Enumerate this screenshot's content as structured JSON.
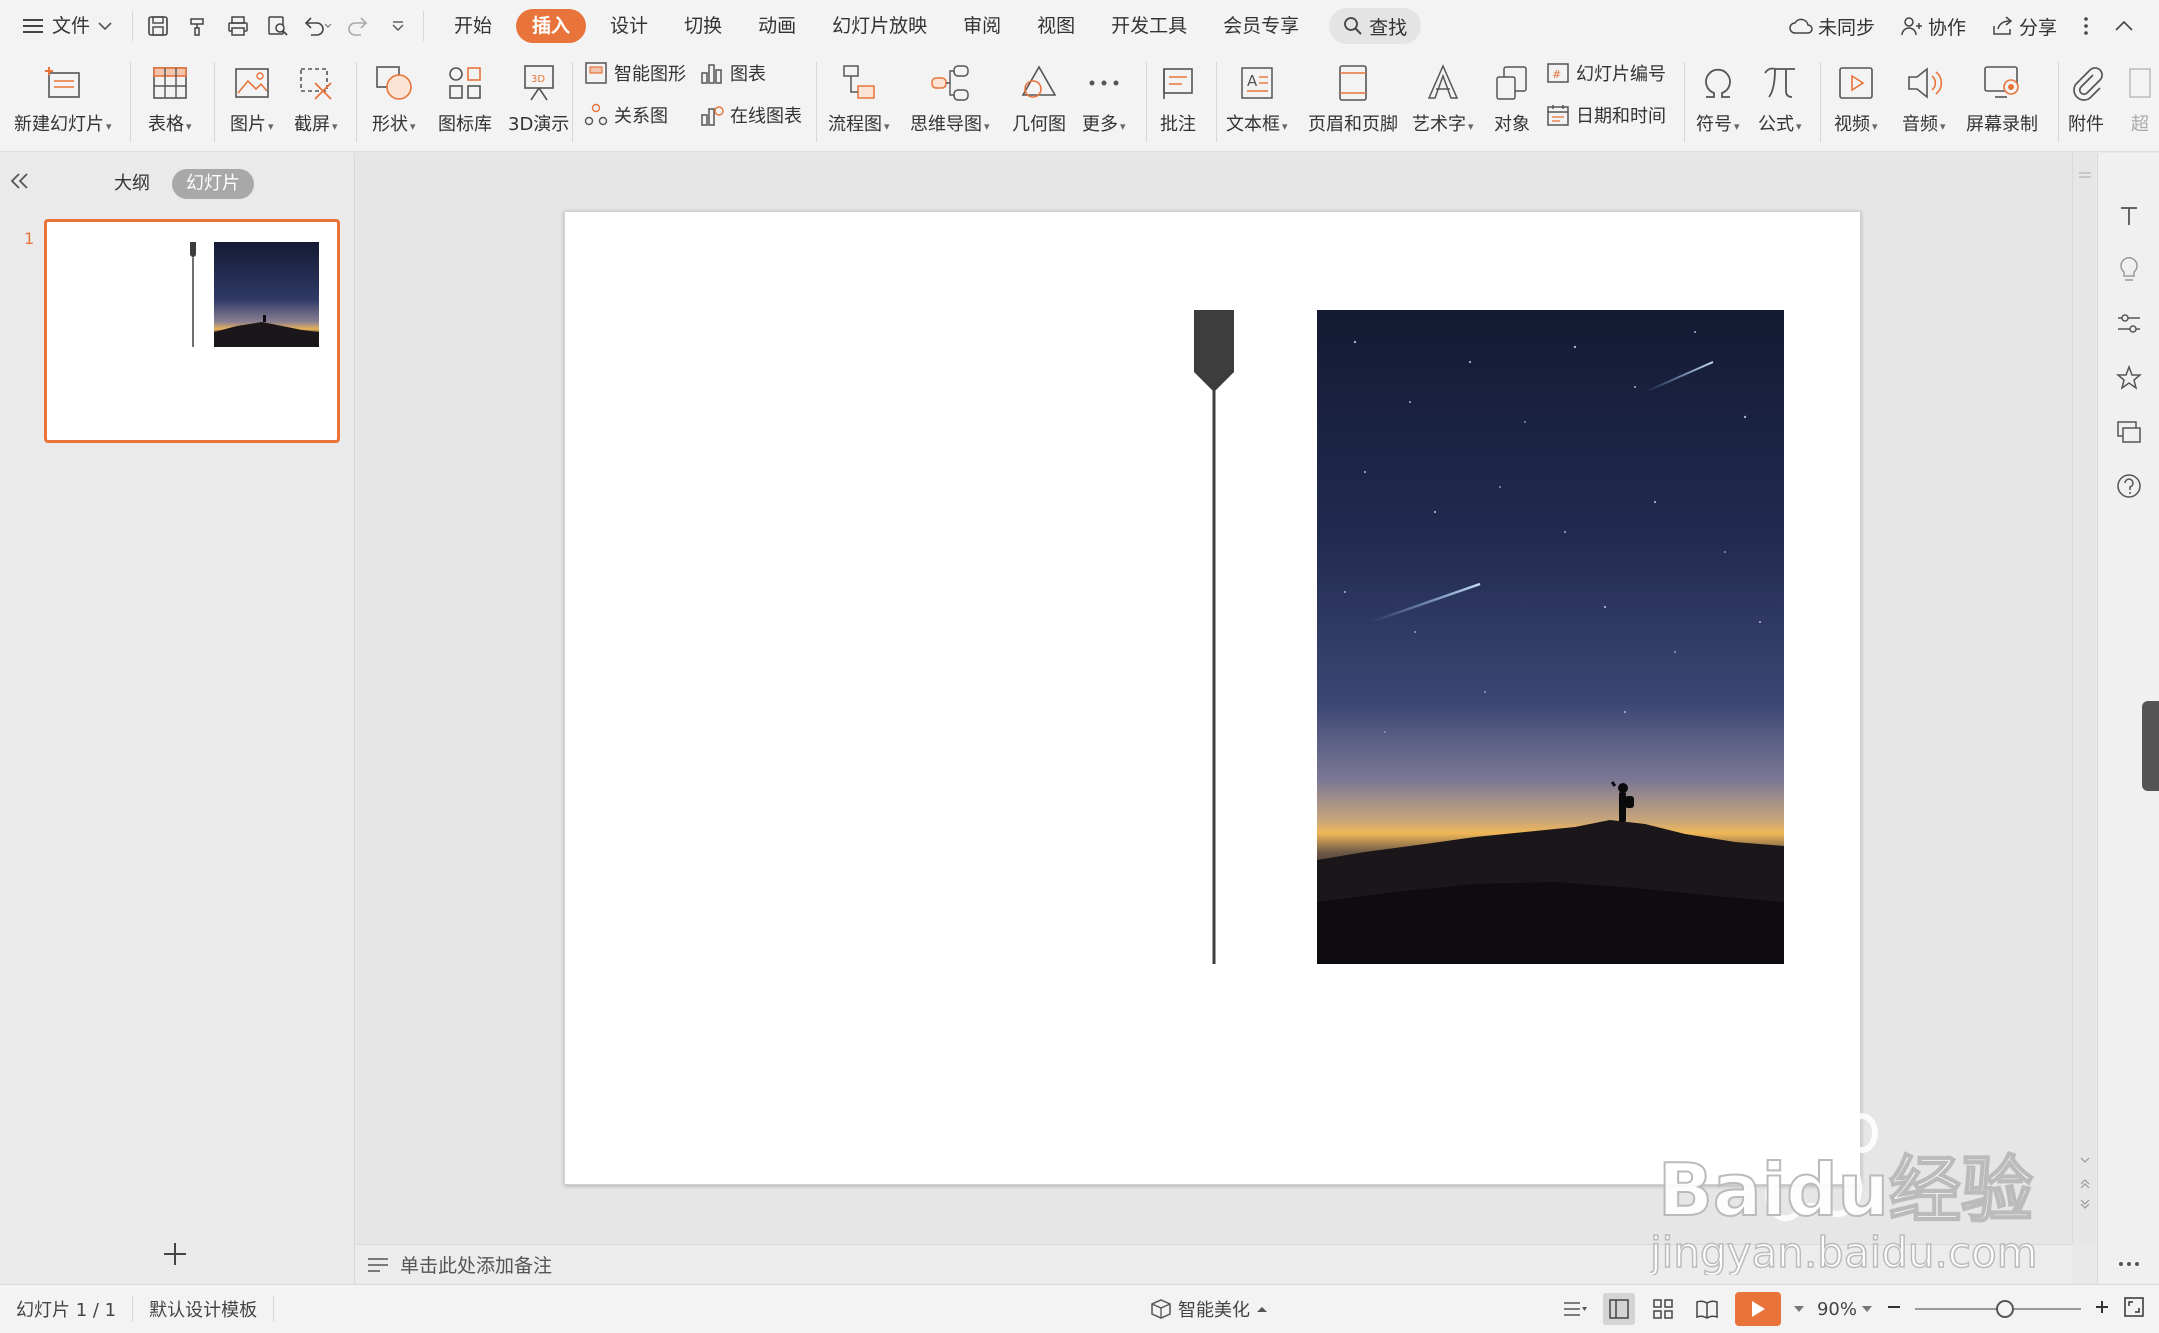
{
  "menubar": {
    "file_label": "文件",
    "tabs": [
      "开始",
      "插入",
      "设计",
      "切换",
      "动画",
      "幻灯片放映",
      "审阅",
      "视图",
      "开发工具",
      "会员专享"
    ],
    "active_tab": "插入",
    "search_label": "查找",
    "sync_label": "未同步",
    "collab_label": "协作",
    "share_label": "分享"
  },
  "ribbon": {
    "new_slide": "新建幻灯片",
    "table": "表格",
    "picture": "图片",
    "screenshot": "截屏",
    "shape": "形状",
    "icon_library": "图标库",
    "demo_3d": "3D演示",
    "smart_graphic": "智能图形",
    "chart": "图表",
    "relation": "关系图",
    "online_chart": "在线图表",
    "flowchart": "流程图",
    "mindmap": "思维导图",
    "geometry": "几何图",
    "more": "更多",
    "comment": "批注",
    "textbox": "文本框",
    "header_footer": "页眉和页脚",
    "wordart": "艺术字",
    "object": "对象",
    "slide_number": "幻灯片编号",
    "date_time": "日期和时间",
    "symbol": "符号",
    "formula": "公式",
    "video": "视频",
    "audio": "音频",
    "screen_record": "屏幕录制",
    "attachment": "附件",
    "overflow": "超"
  },
  "leftpanel": {
    "outline_tab": "大纲",
    "slides_tab": "幻灯片",
    "slide_number": "1"
  },
  "notes": {
    "placeholder": "单击此处添加备注"
  },
  "statusbar": {
    "slide_info": "幻灯片 1 / 1",
    "template": "默认设计模板",
    "beautify": "智能美化",
    "zoom": "90%",
    "zoom_level": 0.54
  },
  "watermark": {
    "brand": "Baidu经验",
    "url": "jingyan.baidu.com"
  },
  "colors": {
    "accent": "#e8743b",
    "marker": "#3d3d3d",
    "sky_top": "#141a33",
    "sky_mid": "#2f3a66",
    "horizon": "#e9b35a"
  }
}
